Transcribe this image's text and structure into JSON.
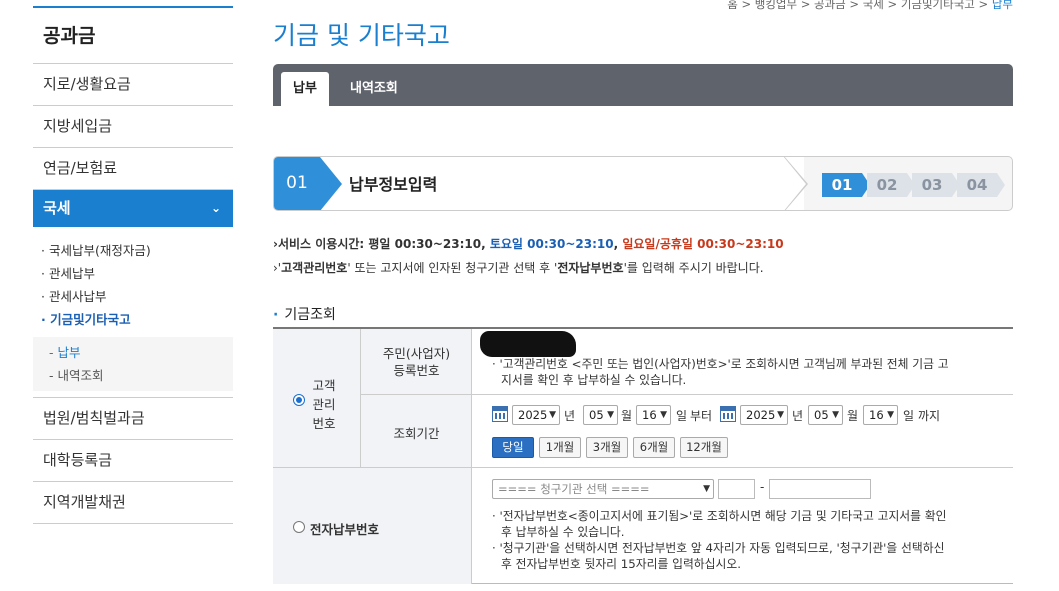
{
  "sidebar": {
    "title": "공과금",
    "items": [
      {
        "label": "지로/생활요금"
      },
      {
        "label": "지방세입금"
      },
      {
        "label": "연금/보험료"
      },
      {
        "label": "국세",
        "chevron": "⌄"
      },
      {
        "label": "법원/범칙벌과금"
      },
      {
        "label": "대학등록금"
      },
      {
        "label": "지역개발채권"
      }
    ],
    "sub": [
      {
        "label": "· 국세납부(재정자금)"
      },
      {
        "label": "· 관세납부"
      },
      {
        "label": "· 관세사납부"
      },
      {
        "label": "· 기금및기타국고"
      }
    ],
    "sub2": [
      {
        "label": "- 납부"
      },
      {
        "label": "- 내역조회"
      }
    ]
  },
  "breadcrumb": {
    "path": "홈 > 뱅킹업무 > 공과금 > 국세 > 기금및기타국고 > ",
    "current": "납부"
  },
  "page_title": "기금 및 기타국고",
  "tabs": [
    {
      "label": "납부"
    },
    {
      "label": "내역조회"
    }
  ],
  "steps": {
    "current_num": "01",
    "current_label": "납부정보입력",
    "all": [
      "01",
      "02",
      "03",
      "04"
    ]
  },
  "notice": {
    "service_prefix": "›서비스 이용시간: 평일 00:30~23:10, ",
    "saturday": "토요일 00:30~23:10",
    "sep": ", ",
    "holiday": "일요일/공휴일 00:30~23:10",
    "line2_a": "›'",
    "line2_b": "고객관리번호",
    "line2_c": "' 또는 고지서에 인자된 청구기관 선택 후 '",
    "line2_d": "전자납부번호",
    "line2_e": "'를 입력해 주시기 바랍니다."
  },
  "section_title": "기금조회",
  "form": {
    "option1_label_l1": "고객",
    "option1_label_l2": "관리",
    "option1_label_l3": "번호",
    "field1_label_l1": "주민(사업자)",
    "field1_label_l2": "등록번호",
    "field1_desc_l1": "· '고객관리번호 <주민 또는 법인(사업자)번호>'로 조회하시면 고객님께 부과된 전체 기금 고",
    "field1_desc_l2": "지서를 확인 후 납부하실 수 있습니다.",
    "field2_label": "조회기간",
    "from": {
      "year": "2025",
      "month": "05",
      "day": "16"
    },
    "to": {
      "year": "2025",
      "month": "05",
      "day": "16"
    },
    "unit_year": "년",
    "unit_month": "월",
    "unit_day": "일",
    "from_suffix": "부터",
    "to_suffix": "까지",
    "period_buttons": [
      "당일",
      "1개월",
      "3개월",
      "6개월",
      "12개월"
    ],
    "option2_label": "전자납부번호",
    "org_select_placeholder": "==== 청구기관 선택 ====",
    "dash": "-",
    "field3_desc_l1": "· '전자납부번호<종이고지서에 표기됨>'로 조회하시면 해당 기금 및 기타국고 고지서를 확인",
    "field3_desc_l2": "후 납부하실 수 있습니다.",
    "field3_desc_l3": "· '청구기관'을 선택하시면 전자납부번호 앞 4자리가 자동 입력되므로, '청구기관'을 선택하신",
    "field3_desc_l4": "후 전자납부번호 뒷자리 15자리를 입력하십시오."
  },
  "colors": {
    "accent": "#1a7fcf",
    "tabbar": "#5f636b",
    "saturday": "#1a5fb4",
    "holiday": "#c8391b"
  }
}
